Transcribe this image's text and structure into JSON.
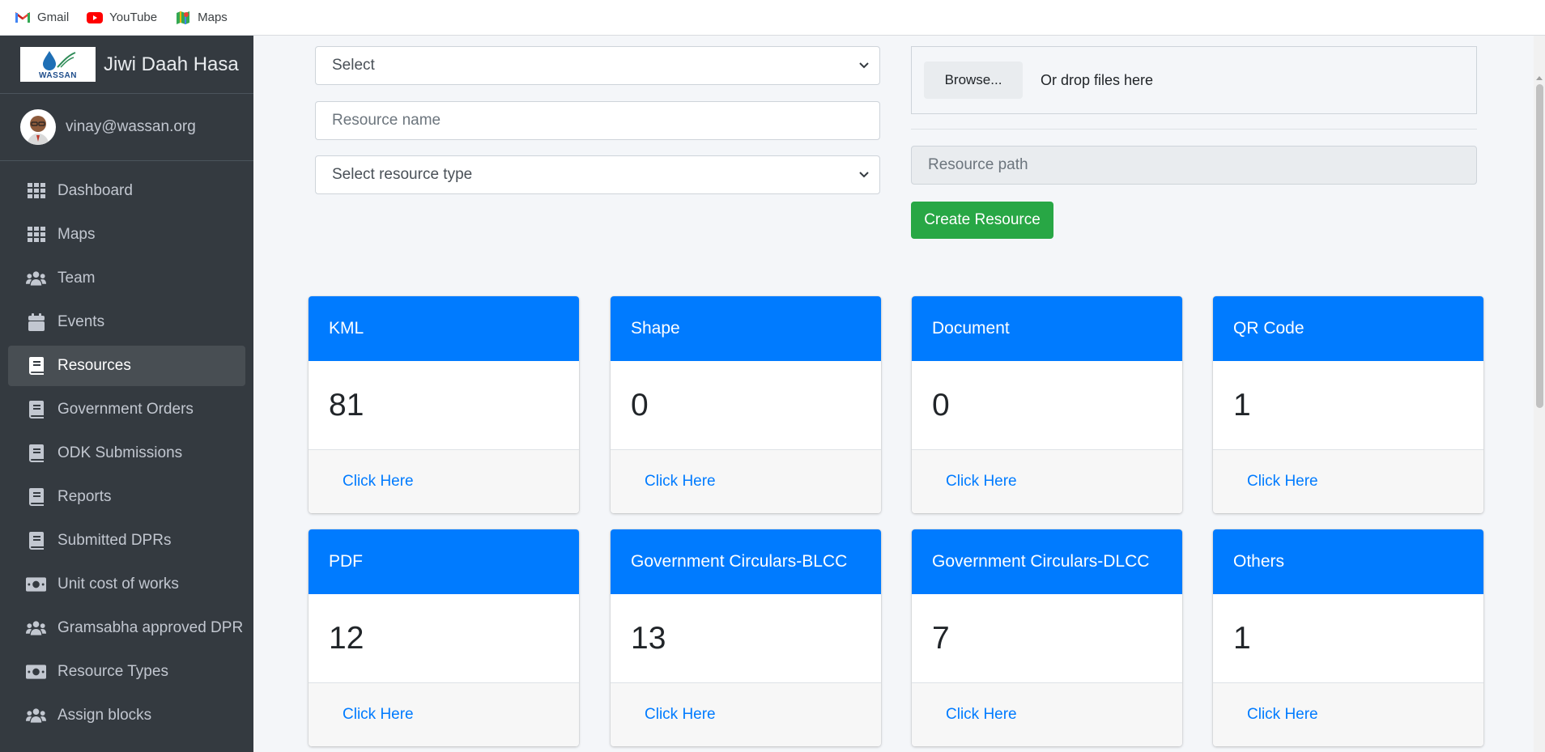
{
  "bookmarks": [
    {
      "label": "Gmail",
      "icon": "gmail-icon"
    },
    {
      "label": "YouTube",
      "icon": "youtube-icon"
    },
    {
      "label": "Maps",
      "icon": "maps-icon"
    }
  ],
  "sidebar": {
    "brand": "Jiwi Daah Hasa",
    "logo_text": "WASSAN",
    "user": "vinay@wassan.org",
    "items": [
      {
        "label": "Dashboard",
        "icon": "grid-icon"
      },
      {
        "label": "Maps",
        "icon": "grid-icon"
      },
      {
        "label": "Team",
        "icon": "users-icon"
      },
      {
        "label": "Events",
        "icon": "calendar-icon"
      },
      {
        "label": "Resources",
        "icon": "book-icon",
        "active": true
      },
      {
        "label": "Government Orders",
        "icon": "book-icon"
      },
      {
        "label": "ODK Submissions",
        "icon": "book-icon"
      },
      {
        "label": "Reports",
        "icon": "book-icon"
      },
      {
        "label": "Submitted DPRs",
        "icon": "book-icon"
      },
      {
        "label": "Unit cost of works",
        "icon": "money-icon"
      },
      {
        "label": "Gramsabha approved DPR",
        "icon": "users-icon"
      },
      {
        "label": "Resource Types",
        "icon": "money-icon"
      },
      {
        "label": "Assign blocks",
        "icon": "users-icon"
      }
    ]
  },
  "form": {
    "select_value": "Select",
    "resource_name_placeholder": "Resource name",
    "resource_type_value": "Select resource type",
    "browse_label": "Browse...",
    "drop_text": "Or drop files here",
    "resource_path_placeholder": "Resource path",
    "create_label": "Create Resource"
  },
  "cards": [
    {
      "title": "KML",
      "value": "81",
      "link": "Click Here"
    },
    {
      "title": "Shape",
      "value": "0",
      "link": "Click Here"
    },
    {
      "title": "Document",
      "value": "0",
      "link": "Click Here"
    },
    {
      "title": "QR Code",
      "value": "1",
      "link": "Click Here"
    },
    {
      "title": "PDF",
      "value": "12",
      "link": "Click Here"
    },
    {
      "title": "Government Circulars-BLCC",
      "value": "13",
      "link": "Click Here"
    },
    {
      "title": "Government Circulars-DLCC",
      "value": "7",
      "link": "Click Here"
    },
    {
      "title": "Others",
      "value": "1",
      "link": "Click Here"
    }
  ],
  "colors": {
    "primary": "#007bff",
    "success": "#28a745",
    "sidebar": "#343a40"
  }
}
